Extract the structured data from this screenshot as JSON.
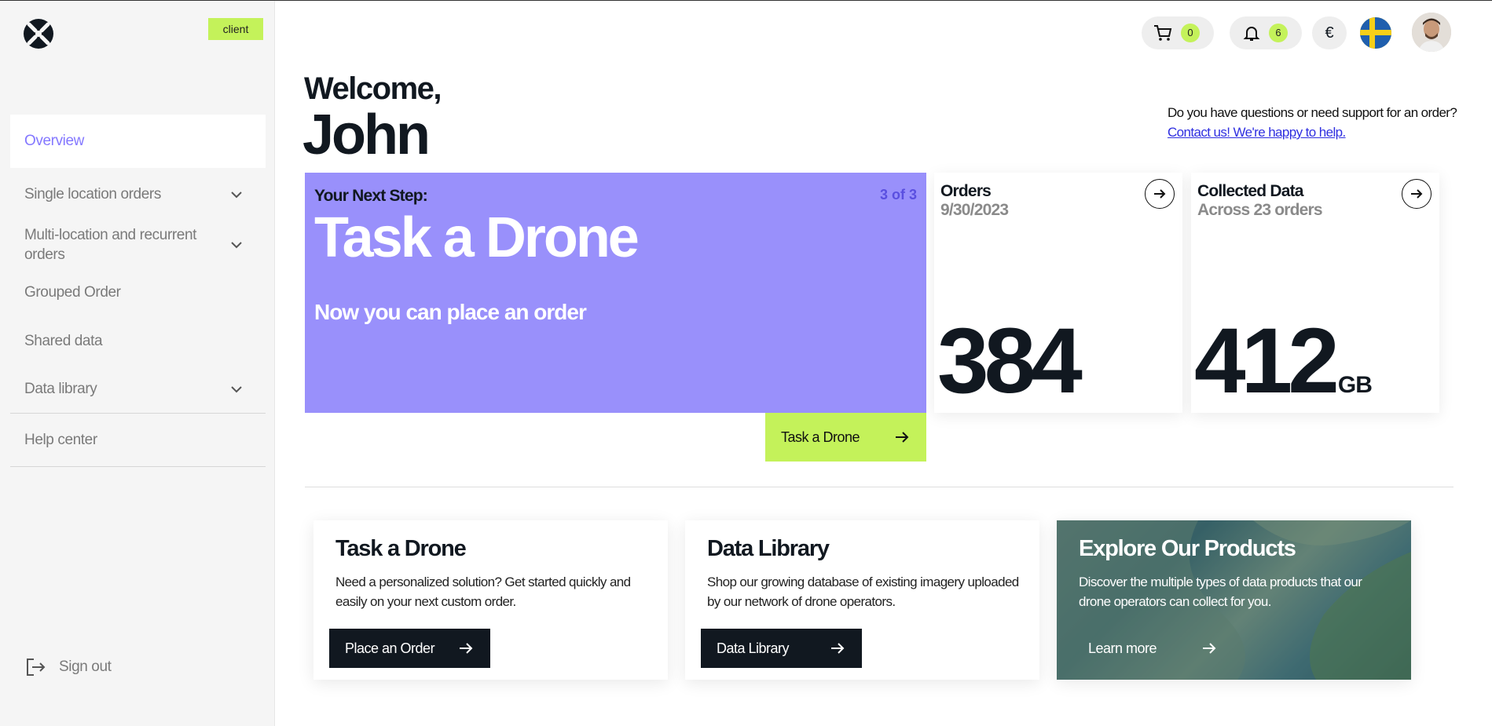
{
  "sidebar": {
    "badge": "client",
    "items": [
      {
        "label": "Overview"
      },
      {
        "label": "Single location orders"
      },
      {
        "label": "Multi-location and recurrent orders"
      },
      {
        "label": "Grouped Order"
      },
      {
        "label": "Shared data"
      },
      {
        "label": "Data library"
      },
      {
        "label": "Help center"
      }
    ],
    "signout": "Sign out"
  },
  "header": {
    "cart_count": "0",
    "notifications_count": "6",
    "currency": "€"
  },
  "welcome": {
    "greeting": "Welcome,",
    "name": "John",
    "support_question": "Do you have questions or need support for an order?",
    "support_link": "Contact us! We're happy to help."
  },
  "next_step": {
    "kicker": "Your Next Step:",
    "counter": "3 of 3",
    "title": "Task a Drone",
    "subtitle": "Now you can place an order",
    "button": "Task a Drone"
  },
  "stats": {
    "orders": {
      "title": "Orders",
      "subtitle": "9/30/2023",
      "value": "384"
    },
    "data": {
      "title": "Collected Data",
      "subtitle": "Across 23 orders",
      "value": "412",
      "unit": "GB"
    }
  },
  "cards": [
    {
      "title": "Task a Drone",
      "desc": "Need a personalized solution? Get started quickly and easily on your next custom order.",
      "button": "Place an Order"
    },
    {
      "title": "Data Library",
      "desc": "Shop our growing database of existing imagery uploaded by our network of drone operators.",
      "button": "Data Library"
    },
    {
      "title": "Explore Our Products",
      "desc": "Discover the multiple types of data products that our drone operators can collect for you.",
      "button": "Learn more"
    }
  ],
  "colors": {
    "accent_purple": "#9990fb",
    "accent_lime": "#c4f25a",
    "dark": "#111820"
  }
}
